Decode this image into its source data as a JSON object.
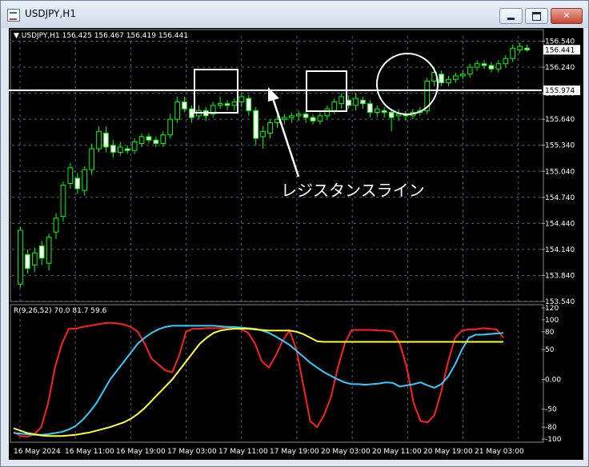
{
  "window": {
    "title": "USDJPY,H1"
  },
  "chart_data": [
    {
      "type": "candlestick",
      "symbol_header": "USDJPY,H1  156.425 156.467 156.419 156.441",
      "ylim": [
        153.54,
        156.6
      ],
      "y_ticks": [
        "156.540",
        "156.240",
        "155.940",
        "155.640",
        "155.340",
        "155.040",
        "154.740",
        "154.440",
        "154.140",
        "153.840",
        "153.540"
      ],
      "price_tags": {
        "current": "156.441",
        "line": "155.974"
      },
      "resistance_level": 155.974,
      "annotation": "レジスタンスライン",
      "x_ticks": [
        "16 May 2024",
        "16 May 11:00",
        "16 May 19:00",
        "17 May 03:00",
        "17 May 11:00",
        "17 May 19:00",
        "20 May 03:00",
        "20 May 11:00",
        "20 May 19:00",
        "21 May 03:00"
      ],
      "candles": [
        [
          153.74,
          154.36,
          153.7,
          154.4
        ],
        [
          154.08,
          153.92,
          153.86,
          154.14
        ],
        [
          153.96,
          154.1,
          153.88,
          154.16
        ],
        [
          154.18,
          154.04,
          153.96,
          154.24
        ],
        [
          153.98,
          154.28,
          153.9,
          154.32
        ],
        [
          154.34,
          154.5,
          154.26,
          154.56
        ],
        [
          154.52,
          154.88,
          154.46,
          154.92
        ],
        [
          154.9,
          155.08,
          154.84,
          155.14
        ],
        [
          154.96,
          154.84,
          154.78,
          155.02
        ],
        [
          154.82,
          155.06,
          154.76,
          155.1
        ],
        [
          155.06,
          155.3,
          155.0,
          155.36
        ],
        [
          155.3,
          155.5,
          155.26,
          155.56
        ],
        [
          155.48,
          155.32,
          155.26,
          155.56
        ],
        [
          155.34,
          155.26,
          155.2,
          155.4
        ],
        [
          155.26,
          155.32,
          155.22,
          155.38
        ],
        [
          155.3,
          155.28,
          155.24,
          155.34
        ],
        [
          155.28,
          155.38,
          155.24,
          155.42
        ],
        [
          155.36,
          155.44,
          155.32,
          155.48
        ],
        [
          155.44,
          155.4,
          155.36,
          155.48
        ],
        [
          155.4,
          155.36,
          155.32,
          155.44
        ],
        [
          155.36,
          155.46,
          155.32,
          155.5
        ],
        [
          155.46,
          155.64,
          155.42,
          155.7
        ],
        [
          155.64,
          155.84,
          155.6,
          155.9
        ],
        [
          155.84,
          155.76,
          155.72,
          155.9
        ],
        [
          155.76,
          155.66,
          155.6,
          155.8
        ],
        [
          155.68,
          155.74,
          155.64,
          155.8
        ],
        [
          155.74,
          155.68,
          155.62,
          155.78
        ],
        [
          155.7,
          155.8,
          155.66,
          155.84
        ],
        [
          155.8,
          155.82,
          155.76,
          155.9
        ],
        [
          155.82,
          155.8,
          155.74,
          155.86
        ],
        [
          155.8,
          155.84,
          155.74,
          155.88
        ],
        [
          155.84,
          155.9,
          155.78,
          155.94
        ],
        [
          155.88,
          155.74,
          155.68,
          155.92
        ],
        [
          155.74,
          155.42,
          155.34,
          155.78
        ],
        [
          155.44,
          155.5,
          155.3,
          155.56
        ],
        [
          155.48,
          155.6,
          155.42,
          155.64
        ],
        [
          155.6,
          155.64,
          155.54,
          155.68
        ],
        [
          155.64,
          155.66,
          155.58,
          155.7
        ],
        [
          155.66,
          155.68,
          155.6,
          155.72
        ],
        [
          155.68,
          155.7,
          155.62,
          155.74
        ],
        [
          155.7,
          155.66,
          155.6,
          155.74
        ],
        [
          155.66,
          155.62,
          155.58,
          155.7
        ],
        [
          155.62,
          155.68,
          155.58,
          155.72
        ],
        [
          155.68,
          155.76,
          155.64,
          155.8
        ],
        [
          155.74,
          155.84,
          155.7,
          155.88
        ],
        [
          155.82,
          155.9,
          155.76,
          155.94
        ],
        [
          155.86,
          155.8,
          155.76,
          155.92
        ],
        [
          155.8,
          155.88,
          155.74,
          155.94
        ],
        [
          155.86,
          155.82,
          155.76,
          155.9
        ],
        [
          155.82,
          155.72,
          155.66,
          155.86
        ],
        [
          155.72,
          155.76,
          155.66,
          155.8
        ],
        [
          155.74,
          155.72,
          155.66,
          155.78
        ],
        [
          155.72,
          155.66,
          155.5,
          155.76
        ],
        [
          155.68,
          155.7,
          155.62,
          155.76
        ],
        [
          155.7,
          155.68,
          155.62,
          155.74
        ],
        [
          155.68,
          155.72,
          155.64,
          155.76
        ],
        [
          155.72,
          155.74,
          155.68,
          155.78
        ],
        [
          155.74,
          156.08,
          155.7,
          156.12
        ],
        [
          156.08,
          156.18,
          156.02,
          156.24
        ],
        [
          156.16,
          156.06,
          156.02,
          156.2
        ],
        [
          156.06,
          156.1,
          156.02,
          156.14
        ],
        [
          156.1,
          156.14,
          156.06,
          156.18
        ],
        [
          156.14,
          156.16,
          156.1,
          156.2
        ],
        [
          156.16,
          156.24,
          156.12,
          156.28
        ],
        [
          156.24,
          156.28,
          156.2,
          156.32
        ],
        [
          156.28,
          156.26,
          156.22,
          156.32
        ],
        [
          156.26,
          156.22,
          156.18,
          156.3
        ],
        [
          156.22,
          156.28,
          156.18,
          156.32
        ],
        [
          156.28,
          156.34,
          156.24,
          156.38
        ],
        [
          156.34,
          156.46,
          156.3,
          156.5
        ],
        [
          156.44,
          156.48,
          156.4,
          156.52
        ],
        [
          156.46,
          156.44,
          156.42,
          156.5
        ]
      ]
    },
    {
      "type": "line",
      "indicator_label": "R(9,26,52) 70.0 81.7 59.6",
      "ylim": [
        -100,
        120
      ],
      "y_ticks": [
        "120",
        "100",
        "80",
        "50",
        "0.00",
        "-50",
        "-80",
        "-100"
      ],
      "x": [
        0,
        4,
        8,
        12,
        16,
        20,
        24,
        28,
        32,
        36,
        40,
        44,
        48,
        52,
        56,
        60,
        64,
        68,
        72,
        76,
        80,
        84,
        88,
        92,
        96,
        100,
        104,
        108,
        112,
        116,
        120,
        124,
        128,
        132,
        136,
        140,
        144,
        148,
        152,
        156,
        160,
        164,
        168,
        172,
        176,
        180,
        184,
        188,
        192,
        196,
        200,
        204,
        208,
        212,
        216,
        220,
        224,
        228,
        232,
        236,
        240,
        244,
        248,
        252,
        256,
        260,
        264,
        268,
        272,
        276,
        280,
        284
      ],
      "series": [
        {
          "color": "#ff2020",
          "values": [
            -88,
            -95,
            -96,
            -92,
            -80,
            -40,
            20,
            60,
            85,
            85,
            88,
            90,
            92,
            94,
            95,
            94,
            92,
            88,
            80,
            60,
            35,
            25,
            15,
            12,
            40,
            80,
            85,
            85,
            86,
            86,
            86,
            87,
            86,
            84,
            78,
            60,
            30,
            20,
            40,
            65,
            82,
            50,
            -10,
            -70,
            -80,
            -60,
            -30,
            20,
            60,
            83,
            83,
            83,
            83,
            82,
            82,
            80,
            60,
            20,
            -40,
            -70,
            -72,
            -60,
            -20,
            30,
            70,
            82,
            84,
            84,
            86,
            85,
            84,
            70
          ]
        },
        {
          "color": "#33ccff",
          "values": [
            -90,
            -91,
            -92,
            -93,
            -93,
            -92,
            -90,
            -88,
            -84,
            -78,
            -68,
            -55,
            -40,
            -20,
            0,
            15,
            30,
            45,
            60,
            70,
            78,
            84,
            88,
            90,
            90,
            90,
            90,
            90,
            90,
            90,
            89,
            88,
            88,
            87,
            86,
            85,
            82,
            78,
            72,
            65,
            58,
            48,
            38,
            28,
            20,
            12,
            6,
            0,
            -5,
            -8,
            -8,
            -9,
            -8,
            -7,
            -5,
            -6,
            -12,
            -10,
            -8,
            -5,
            -10,
            -14,
            -8,
            5,
            25,
            50,
            70,
            75,
            75,
            76,
            77,
            78
          ]
        },
        {
          "color": "#ffff33",
          "values": [
            -82,
            -86,
            -90,
            -92,
            -94,
            -95,
            -95,
            -95,
            -94,
            -93,
            -91,
            -89,
            -86,
            -83,
            -80,
            -76,
            -72,
            -66,
            -58,
            -48,
            -36,
            -24,
            -12,
            0,
            15,
            30,
            45,
            60,
            70,
            78,
            82,
            84,
            85,
            85,
            85,
            84,
            83,
            82,
            82,
            82,
            82,
            80,
            76,
            70,
            64,
            63,
            63,
            63,
            63,
            63,
            63,
            63,
            63,
            63,
            63,
            63,
            63,
            63,
            63,
            63,
            63,
            63,
            63,
            63,
            63,
            63,
            63,
            63,
            63,
            63,
            63,
            63
          ]
        }
      ]
    }
  ]
}
